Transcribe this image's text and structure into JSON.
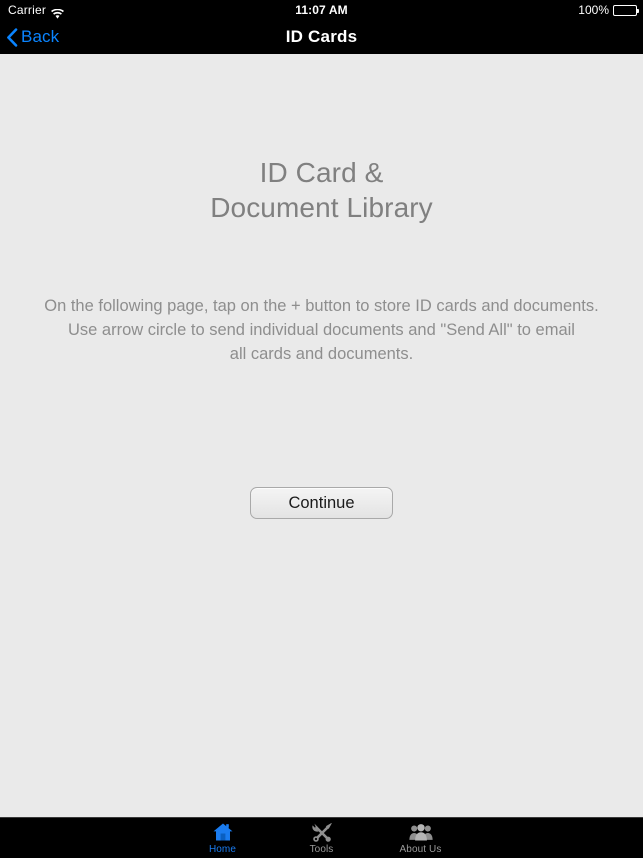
{
  "status_bar": {
    "carrier": "Carrier",
    "wifi_icon": "wifi-icon",
    "time": "11:07 AM",
    "battery_percent": "100%",
    "battery_icon": "battery-full-icon"
  },
  "nav_bar": {
    "back_icon": "chevron-left-icon",
    "back_label": "Back",
    "title": "ID Cards"
  },
  "main": {
    "title_line1": "ID Card &",
    "title_line2": "Document Library",
    "description_line1": "On the following page, tap on the + button to store ID cards and documents.",
    "description_line2": "Use arrow circle to send individual documents and \"Send All\" to email",
    "description_line3": "all cards and documents.",
    "continue_label": "Continue"
  },
  "tab_bar": {
    "items": [
      {
        "label": "Home",
        "icon": "home-icon",
        "active": true
      },
      {
        "label": "Tools",
        "icon": "tools-icon",
        "active": false
      },
      {
        "label": "About Us",
        "icon": "people-icon",
        "active": false
      }
    ]
  },
  "colors": {
    "accent_blue": "#0a84ff",
    "tab_active_blue": "#1a7cf0",
    "background": "#eaeaea",
    "bar_black": "#000000",
    "title_gray": "#808080",
    "text_gray": "#8e8e8e",
    "tab_inactive_gray": "#9a9a9a"
  }
}
